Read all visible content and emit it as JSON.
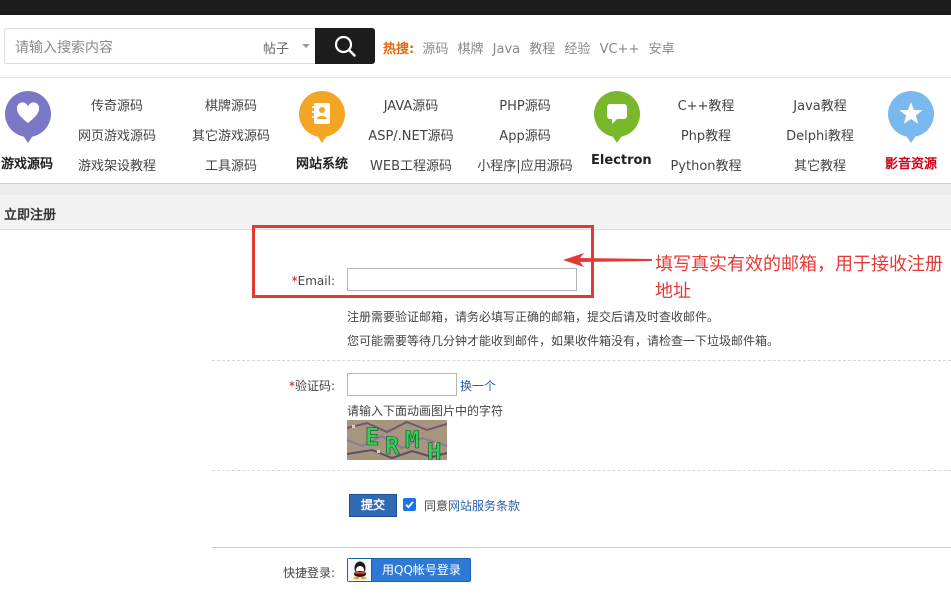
{
  "search": {
    "placeholder": "请输入搜索内容",
    "scope": "帖子"
  },
  "hot": {
    "label": "热搜:",
    "links": [
      "源码",
      "棋牌",
      "Java",
      "教程",
      "经验",
      "VC++",
      "安卓"
    ]
  },
  "nav": {
    "groups": [
      {
        "title": "游戏源码",
        "icon": "heart-icon",
        "color": "#7a78c4",
        "links": [
          "传奇源码",
          "网页游戏源码",
          "游戏架设教程",
          "棋牌源码",
          "其它游戏源码",
          "工具源码"
        ]
      },
      {
        "title": "网站系统",
        "icon": "contacts-book-icon",
        "color": "#f5a524",
        "links": [
          "JAVA源码",
          "ASP/.NET源码",
          "WEB工程源码",
          "PHP源码",
          "App源码",
          "小程序|应用源码"
        ]
      },
      {
        "title": "Electron",
        "icon": "chat-bubble-icon",
        "color": "#78b82a",
        "links": [
          "C++教程",
          "Php教程",
          "Python教程",
          "Java教程",
          "Delphi教程",
          "其它教程"
        ]
      },
      {
        "title": "影音资源",
        "icon": "star-icon",
        "color": "#79b9f0",
        "title_color": "#d0021b",
        "links": []
      }
    ]
  },
  "section": {
    "title": "立即注册"
  },
  "form": {
    "email": {
      "required_mark": "*",
      "label": "Email:",
      "value": "",
      "hint1": "注册需要验证邮箱，请务必填写正确的邮箱，提交后请及时查收邮件。",
      "hint2": "您可能需要等待几分钟才能收到邮件，如果收件箱没有，请检查一下垃圾邮件箱。"
    },
    "captcha": {
      "required_mark": "*",
      "label": "验证码:",
      "value": "",
      "refresh": "换一个",
      "hint": "请输入下面动画图片中的字符",
      "image_text": "ERMH"
    },
    "submit_label": "提交",
    "agree_prefix": "同意",
    "agree_link": "网站服务条款",
    "agree_checked": true,
    "quick_login_label": "快捷登录:",
    "qq_login_label": "用QQ帐号登录"
  },
  "annotation": {
    "text": "填写真实有效的邮箱，用于接收注册地址",
    "color": "#e53935"
  }
}
